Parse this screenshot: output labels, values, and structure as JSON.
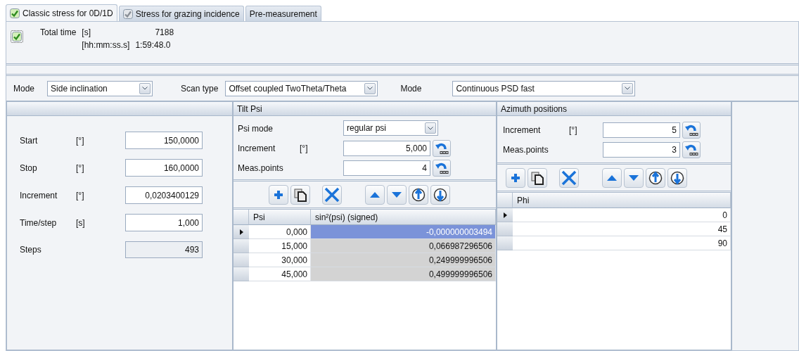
{
  "tabs": [
    {
      "label": "Classic stress for 0D/1D",
      "selected": true,
      "kind": "check"
    },
    {
      "label": "Stress for grazing incidence",
      "selected": false,
      "kind": "dimcheck"
    },
    {
      "label": "Pre-measurement",
      "selected": false,
      "kind": "plain"
    }
  ],
  "total_time": {
    "checked": true,
    "label": "Total time",
    "rows": [
      {
        "unit": "[s]",
        "value": "7188"
      },
      {
        "unit": "[hh:mm:ss.s]",
        "value": "1:59:48.0"
      }
    ]
  },
  "mode_bar": [
    {
      "label": "Mode",
      "value": "Side inclination"
    },
    {
      "label": "Scan type",
      "value": "Offset coupled TwoTheta/Theta"
    },
    {
      "label": "Mode",
      "value": "Continuous PSD fast"
    }
  ],
  "scan": {
    "fields": [
      {
        "label": "Start",
        "unit": "[°]",
        "value": "150,0000",
        "readonly": false
      },
      {
        "label": "Stop",
        "unit": "[°]",
        "value": "160,0000",
        "readonly": false
      },
      {
        "label": "Increment",
        "unit": "[°]",
        "value": "0,0203400129",
        "readonly": false
      },
      {
        "label": "Time/step",
        "unit": "[s]",
        "value": "1,000",
        "readonly": false
      },
      {
        "label": "Steps",
        "value": "493",
        "readonly": true
      }
    ]
  },
  "tilt": {
    "title": "Tilt Psi",
    "psi_mode": {
      "label": "Psi mode",
      "value": "regular psi"
    },
    "fields": [
      {
        "label": "Increment",
        "unit": "[°]",
        "value": "5,000"
      },
      {
        "label": "Meas.points",
        "value": "4"
      }
    ],
    "columns": [
      "Psi",
      "sin²(psi) (signed)"
    ],
    "rows": [
      {
        "cells": [
          "0,000",
          "-0,000000003494"
        ],
        "selected": true
      },
      {
        "cells": [
          "15,000",
          "0,066987296506"
        ],
        "selected": false
      },
      {
        "cells": [
          "30,000",
          "0,249999996506"
        ],
        "selected": false
      },
      {
        "cells": [
          "45,000",
          "0,499999996506"
        ],
        "selected": false
      }
    ]
  },
  "azimuth": {
    "title": "Azimuth positions",
    "fields": [
      {
        "label": "Increment",
        "unit": "[°]",
        "value": "5"
      },
      {
        "label": "Meas.points",
        "value": "3"
      }
    ],
    "columns": [
      "Phi"
    ],
    "rows": [
      {
        "cells": [
          "0"
        ],
        "selected": true
      },
      {
        "cells": [
          "45"
        ],
        "selected": false
      },
      {
        "cells": [
          "90"
        ],
        "selected": false
      }
    ]
  }
}
